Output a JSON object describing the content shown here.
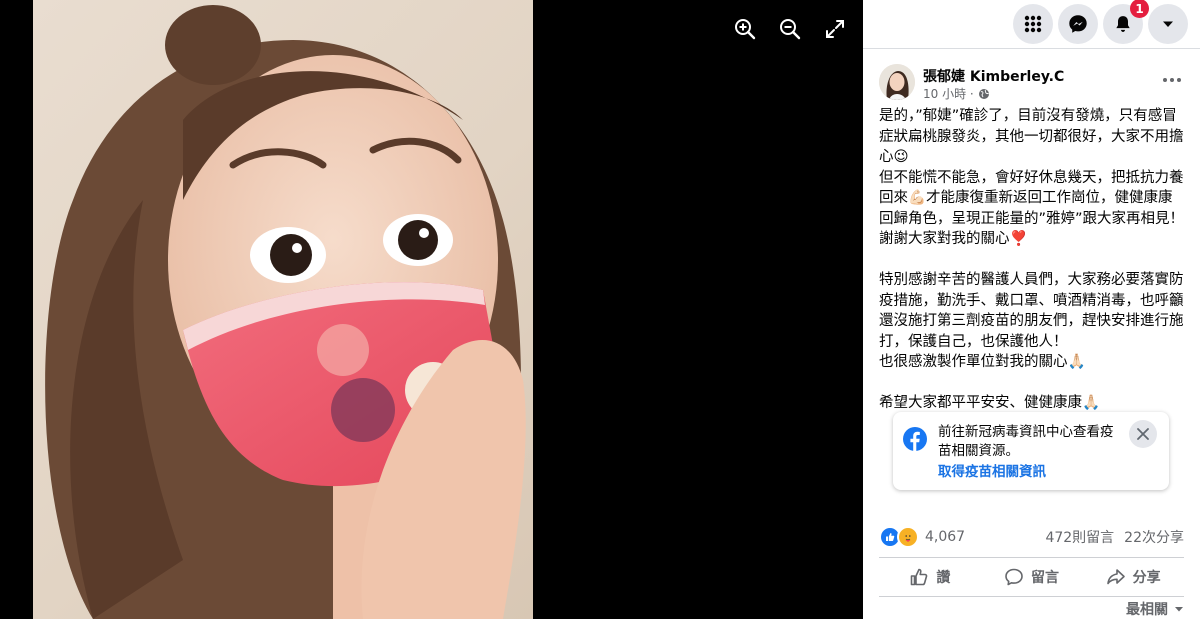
{
  "viewer": {
    "photo_alt": "張郁婕 Kimberley.C",
    "controls": [
      "zoom-in-icon",
      "zoom-out-icon",
      "fullscreen-icon"
    ]
  },
  "topbar": {
    "icons": [
      "menu-grid-icon",
      "messenger-icon",
      "notifications-icon",
      "account-caret-icon"
    ],
    "notification_count": "1"
  },
  "post": {
    "author": "張郁婕 Kimberley.C",
    "time": "10 小時 · ",
    "privacy_icon": "globe-icon",
    "lines": [
      "是的，”郁婕”確診了，目前沒有發燒，只有感冒症狀扁桃腺發炎，其他一切都很好，大家不用擔心😉",
      "但不能慌不能急，會好好休息幾天，把抵抗力養回來💪🏻才能康復重新返回工作崗位，健健康康回歸角色，呈現正能量的”雅婷”跟大家再相見！",
      "謝謝大家對我的關心❣️",
      "",
      "特別感謝辛苦的醫護人員們，大家務必要落實防疫措施，勤洗手、戴口罩、噴酒精消毒，也呼籲還沒施打第三劑疫苗的朋友們，趕快安排進行施打，保護自己，也保護他人！",
      "也很感激製作單位對我的關心🙏🏻",
      "",
      "希望大家都平平安安、健健康康🙏🏻"
    ]
  },
  "info_card": {
    "text": "前往新冠病毒資訊中心查看疫苗相關資源。",
    "link": "取得疫苗相關資訊"
  },
  "stats": {
    "reactions_count": "4,067",
    "comments": "472則留言",
    "shares": "22次分享"
  },
  "actions": {
    "like": "讚",
    "comment": "留言",
    "share": "分享"
  },
  "sort": {
    "label": "最相關"
  },
  "colors": {
    "accent": "#1b74e4",
    "badge": "#e41e3f",
    "like_blue": "#1877f2"
  }
}
